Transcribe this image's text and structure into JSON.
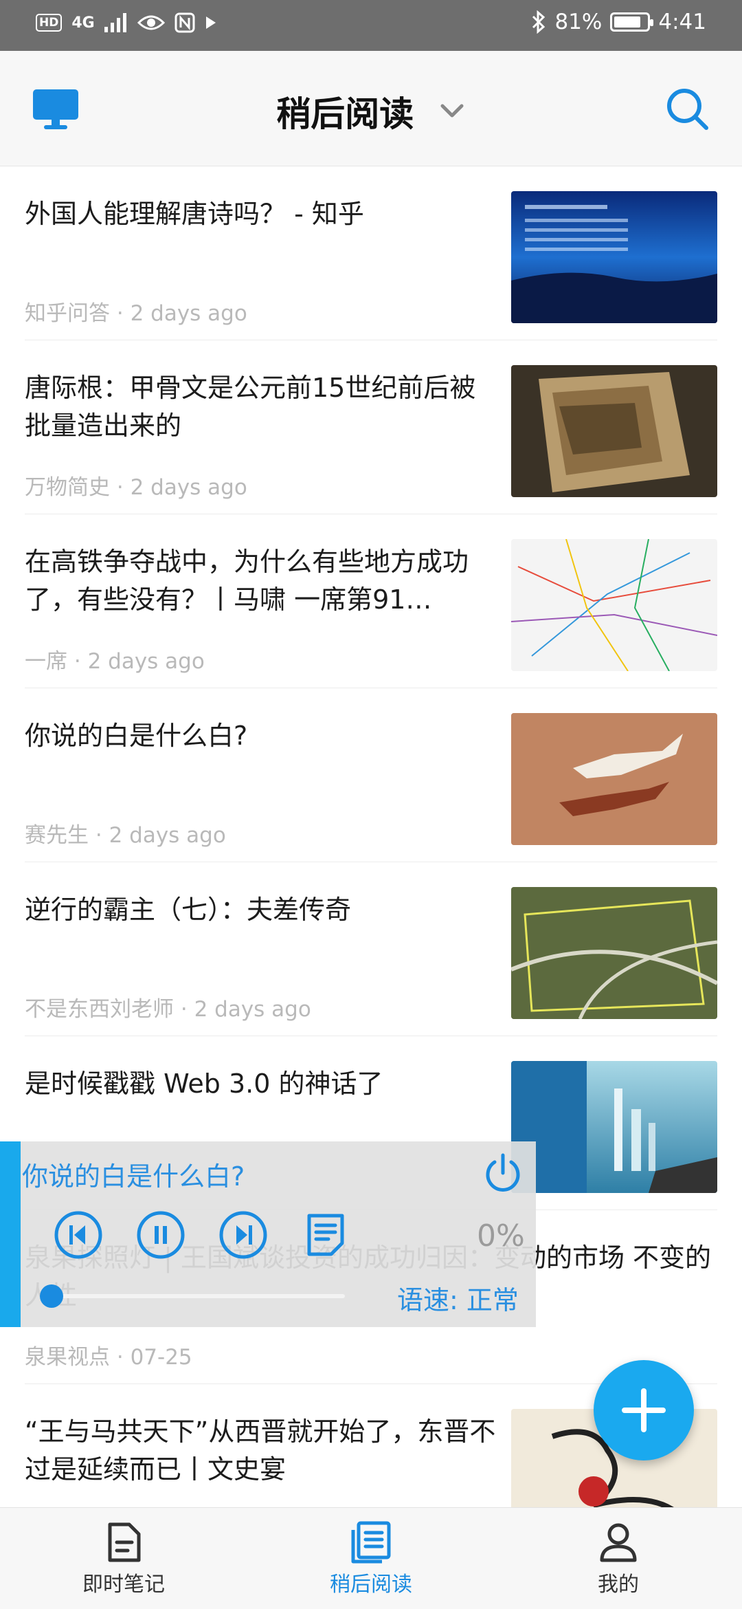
{
  "status_bar": {
    "network": "4G",
    "hd_badge": "HD",
    "battery_percent": "81%",
    "battery_level": 0.81,
    "time": "4:41"
  },
  "header": {
    "title": "稍后阅读",
    "left_icon": "monitor-icon",
    "search_icon": "search-icon"
  },
  "articles": [
    {
      "title": "外国人能理解唐诗吗？ - 知乎",
      "source": "知乎问答",
      "time": "2 days ago"
    },
    {
      "title": "唐际根：甲骨文是公元前15世纪前后被批量造出来的",
      "source": "万物简史",
      "time": "2 days ago"
    },
    {
      "title": "在高铁争夺战中，为什么有些地方成功了，有些没有？丨马啸 一席第91…",
      "source": "一席",
      "time": "2 days ago"
    },
    {
      "title": "你说的白是什么白?",
      "source": "赛先生",
      "time": "2 days ago"
    },
    {
      "title": "逆行的霸主（七）：夫差传奇",
      "source": "不是东西刘老师",
      "time": "2 days ago"
    },
    {
      "title": "是时候戳戳 Web 3.0 的神话了",
      "source": "",
      "time": ""
    },
    {
      "title": "泉果探照灯 | 王国斌谈投资的成功归因：变动的市场 不变的人性",
      "source": "泉果视点",
      "time": "07-25"
    },
    {
      "title": "“王与马共天下”从西晋就开始了，东晋不过是延续而已丨文史宴",
      "source": "",
      "time": ""
    }
  ],
  "meta_separator": "·",
  "player": {
    "title": "你说的白是什么白?",
    "percent": "0%",
    "progress": 0,
    "speed_label": "语速: 正常"
  },
  "bottom_nav": [
    {
      "label": "即时笔记",
      "icon": "note-icon",
      "active": false
    },
    {
      "label": "稍后阅读",
      "icon": "reading-list-icon",
      "active": true
    },
    {
      "label": "我的",
      "icon": "profile-icon",
      "active": false
    }
  ],
  "colors": {
    "accent": "#1a8be0",
    "fab": "#1aa9ef",
    "meta_text": "#b9b9b9"
  }
}
